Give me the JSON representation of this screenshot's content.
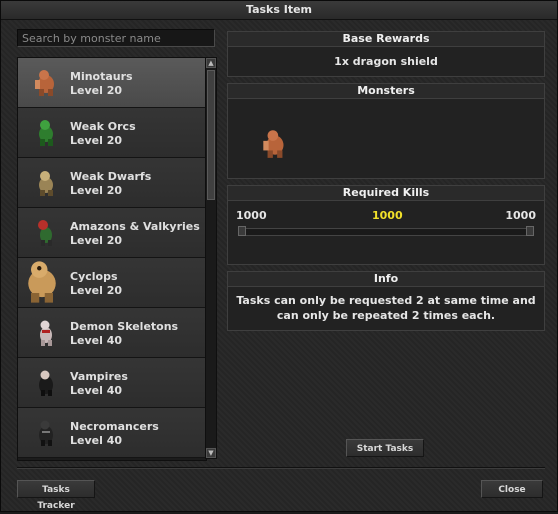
{
  "window": {
    "title": "Tasks Item"
  },
  "search": {
    "placeholder": "Search by monster name",
    "value": ""
  },
  "monsters": [
    {
      "name": "Minotaurs",
      "level": "Level 20",
      "icon": "minotaur-icon",
      "selected": true
    },
    {
      "name": "Weak Orcs",
      "level": "Level 20",
      "icon": "orc-icon"
    },
    {
      "name": "Weak Dwarfs",
      "level": "Level 20",
      "icon": "dwarf-icon"
    },
    {
      "name": "Amazons & Valkyries",
      "level": "Level 20",
      "icon": "amazon-icon"
    },
    {
      "name": "Cyclops",
      "level": "Level 20",
      "icon": "cyclops-icon"
    },
    {
      "name": "Demon Skeletons",
      "level": "Level 40",
      "icon": "demon-skeleton-icon"
    },
    {
      "name": "Vampires",
      "level": "Level 40",
      "icon": "vampire-icon"
    },
    {
      "name": "Necromancers",
      "level": "Level 40",
      "icon": "necromancer-icon"
    }
  ],
  "rewards": {
    "header": "Base Rewards",
    "text": "1x dragon shield"
  },
  "monsters_panel": {
    "header": "Monsters",
    "icon": "minotaur-icon"
  },
  "kills": {
    "header": "Required Kills",
    "min": "1000",
    "current": "1000",
    "max": "1000"
  },
  "info": {
    "header": "Info",
    "text": "Tasks can only be requested 2 at same time and can only be repeated 2 times each."
  },
  "buttons": {
    "start": "Start Tasks",
    "tracker": "Tasks Tracker",
    "close": "Close"
  },
  "colors": {
    "current_kills": "#f2e12a",
    "selected_row": "#525252"
  }
}
